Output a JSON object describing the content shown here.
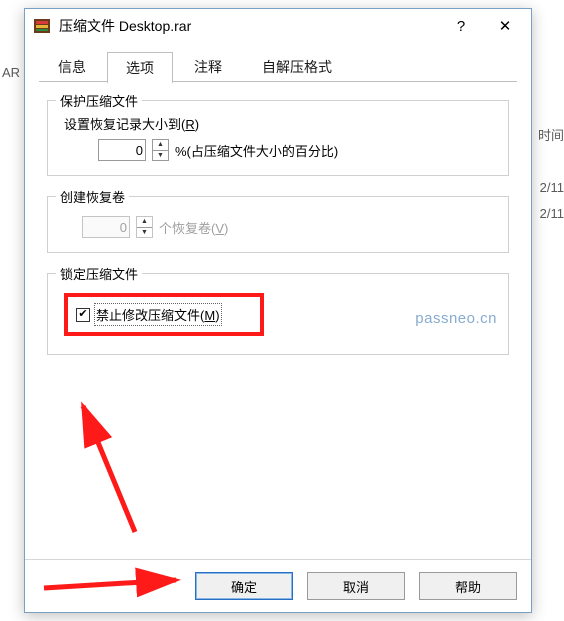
{
  "background": {
    "left_text": "AR 压",
    "col_header": "时间",
    "row_date": "2/11"
  },
  "dialog": {
    "title": "压缩文件 Desktop.rar",
    "help_symbol": "?",
    "close_symbol": "✕"
  },
  "tabs": {
    "t0": "信息",
    "t1": "选项",
    "t2": "注释",
    "t3": "自解压格式"
  },
  "protect": {
    "title": "保护压缩文件",
    "label_pre": "设置恢复记录大小到(",
    "label_key": "R",
    "label_post": ")",
    "value": "0",
    "suffix": "%(占压缩文件大小的百分比)"
  },
  "recovery": {
    "title": "创建恢复卷",
    "value": "0",
    "label_pre": "个恢复卷(",
    "label_key": "V",
    "label_post": ")"
  },
  "lock": {
    "title": "锁定压缩文件",
    "checkbox_pre": "禁止修改压缩文件(",
    "checkbox_key": "M",
    "checkbox_post": ")",
    "checked_glyph": "✔"
  },
  "watermark": "passneo.cn",
  "buttons": {
    "ok": "确定",
    "cancel": "取消",
    "help": "帮助"
  }
}
